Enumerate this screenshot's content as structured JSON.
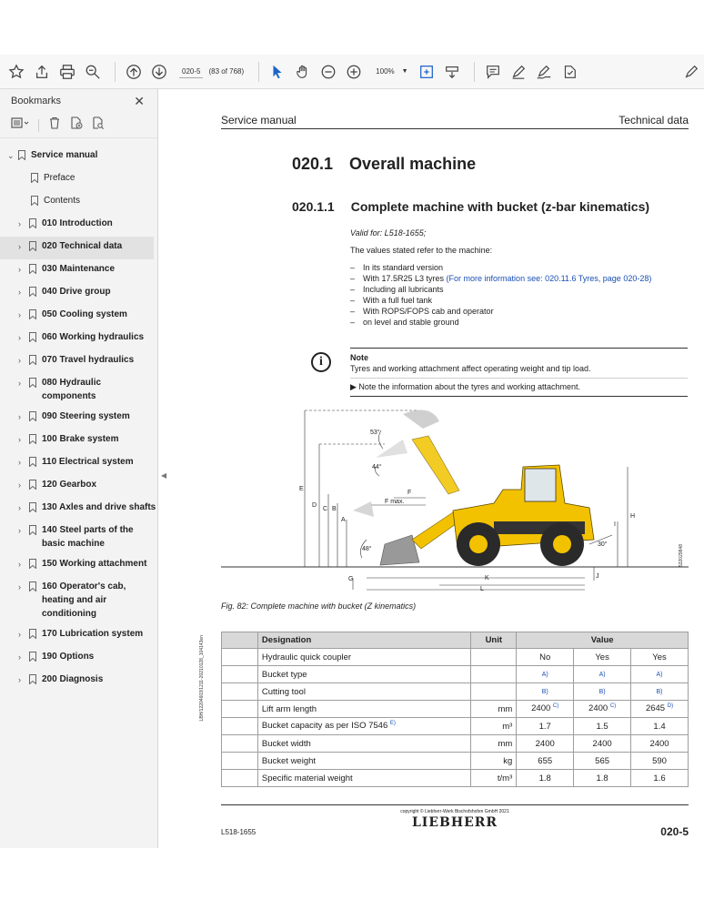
{
  "toolbar": {
    "page_field": "020-5",
    "page_of": "(83 of 768)",
    "zoom": "100%"
  },
  "sidebar": {
    "title": "Bookmarks",
    "close_glyph": "✕",
    "items": [
      {
        "label": "Service manual"
      },
      {
        "label": "Preface"
      },
      {
        "label": "Contents"
      },
      {
        "label": "010 Introduction"
      },
      {
        "label": "020 Technical data"
      },
      {
        "label": "030 Maintenance"
      },
      {
        "label": "040 Drive group"
      },
      {
        "label": "050 Cooling system"
      },
      {
        "label": "060 Working hydraulics"
      },
      {
        "label": "070 Travel hydraulics"
      },
      {
        "label": "080 Hydraulic components"
      },
      {
        "label": "090 Steering system"
      },
      {
        "label": "100 Brake system"
      },
      {
        "label": "110 Electrical system"
      },
      {
        "label": "120 Gearbox"
      },
      {
        "label": "130 Axles and drive shafts"
      },
      {
        "label": "140 Steel parts of the basic machine"
      },
      {
        "label": "150 Working attachment"
      },
      {
        "label": "160 Operator's cab, heating and air conditioning"
      },
      {
        "label": "170 Lubrication system"
      },
      {
        "label": "190 Options"
      },
      {
        "label": "200 Diagnosis"
      }
    ]
  },
  "page": {
    "header_left": "Service manual",
    "header_right": "Technical data",
    "h1_num": "020.1",
    "h1_text": "Overall machine",
    "h2_num": "020.1.1",
    "h2_text": "Complete machine with bucket (z-bar kinematics)",
    "valid_for": "Valid for: L518-1655;",
    "intro": "The values stated refer to the machine:",
    "bullets": {
      "b1": "In its standard version",
      "b2_pre": "With 17.5R25 L3 tyres ",
      "b2_link": "(For more information see: 020.11.6 Tyres, page 020-28)",
      "b3": "Including all lubricants",
      "b4": "With a full fuel tank",
      "b5": "With ROPS/FOPS cab and operator",
      "b6": "on level and stable ground"
    },
    "note_title": "Note",
    "note_text": "Tyres and working attachment affect operating weight and tip load.",
    "note_action": "▶  Note the information about the tyres and working attachment.",
    "figure_labels": {
      "angle_53": "53°",
      "angle_44": "44°",
      "angle_48": "48°",
      "angle_30": "30°",
      "E": "E",
      "D": "D",
      "C": "C",
      "B": "B",
      "A": "A",
      "F": "F",
      "Fmax": "F max.",
      "G": "G",
      "K": "K",
      "L": "L",
      "J": "J",
      "H": "H",
      "I": "I"
    },
    "figure_code": "532029848",
    "figure_caption": "Fig. 82: Complete machine with bucket (Z kinematics)",
    "side_code": "LBH/12204603/1211-20210128_104143en",
    "table": {
      "headers": {
        "designation": "Designation",
        "unit": "Unit",
        "value": "Value"
      },
      "rows": [
        {
          "name": "Hydraulic quick coupler",
          "unit": "",
          "v1": "No",
          "v2": "Yes",
          "v3": "Yes"
        },
        {
          "name": "Bucket type",
          "unit": "",
          "v1": "A)",
          "v2": "A)",
          "v3": "A)"
        },
        {
          "name": "Cutting tool",
          "unit": "",
          "v1": "B)",
          "v2": "B)",
          "v3": "B)"
        },
        {
          "name": "Lift arm length",
          "unit": "mm",
          "v1": "2400",
          "v1_fn": "C)",
          "v2": "2400",
          "v2_fn": "C)",
          "v3": "2645",
          "v3_fn": "D)"
        },
        {
          "name": "Bucket capacity as per ISO 7546",
          "name_fn": "E)",
          "unit": "m³",
          "v1": "1.7",
          "v2": "1.5",
          "v3": "1.4"
        },
        {
          "name": "Bucket width",
          "unit": "mm",
          "v1": "2400",
          "v2": "2400",
          "v3": "2400"
        },
        {
          "name": "Bucket weight",
          "unit": "kg",
          "v1": "655",
          "v2": "565",
          "v3": "590"
        },
        {
          "name": "Specific material weight",
          "unit": "t/m³",
          "v1": "1.8",
          "v2": "1.8",
          "v3": "1.6"
        }
      ]
    },
    "copyright": "copyright © Liebherr-Werk Bischofshofen GmbH 2021",
    "logo": "LIEBHERR",
    "footer_left": "L518-1655",
    "footer_right": "020-5"
  }
}
